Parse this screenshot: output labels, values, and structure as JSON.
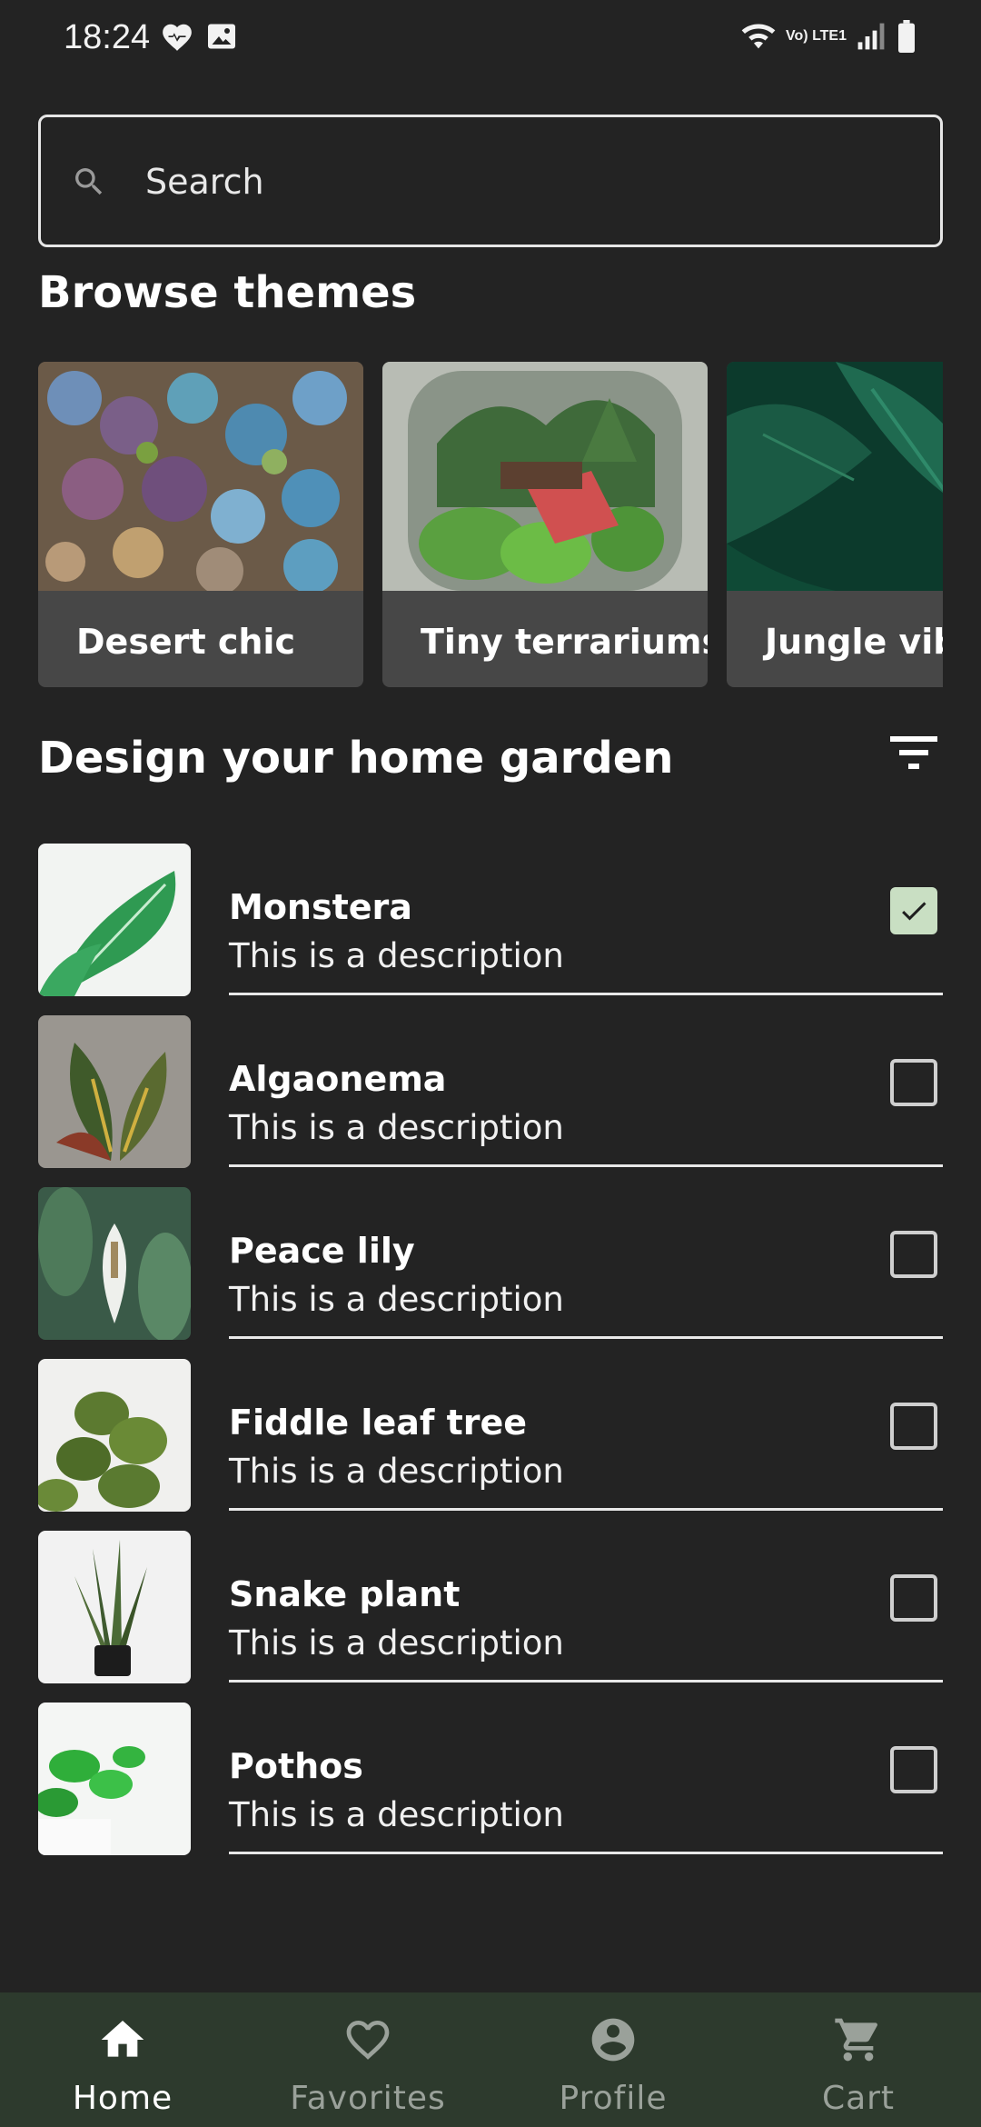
{
  "status_bar": {
    "time": "18:24",
    "network": "Vo) LTE1"
  },
  "search": {
    "placeholder": "Search"
  },
  "browse": {
    "title": "Browse themes",
    "themes": [
      {
        "label": "Desert chic"
      },
      {
        "label": "Tiny terrariums"
      },
      {
        "label": "Jungle vibes"
      }
    ]
  },
  "garden": {
    "title": "Design your home garden",
    "plants": [
      {
        "name": "Monstera",
        "description": "This is a description",
        "checked": true
      },
      {
        "name": "Algaonema",
        "description": "This is a description",
        "checked": false
      },
      {
        "name": "Peace lily",
        "description": "This is a description",
        "checked": false
      },
      {
        "name": "Fiddle leaf tree",
        "description": "This is a description",
        "checked": false
      },
      {
        "name": "Snake plant",
        "description": "This is a description",
        "checked": false
      },
      {
        "name": "Pothos",
        "description": "This is a description",
        "checked": false
      }
    ]
  },
  "nav": {
    "items": [
      {
        "label": "Home",
        "icon": "home-icon",
        "active": true
      },
      {
        "label": "Favorites",
        "icon": "heart-icon",
        "active": false
      },
      {
        "label": "Profile",
        "icon": "account-icon",
        "active": false
      },
      {
        "label": "Cart",
        "icon": "cart-icon",
        "active": false
      }
    ]
  },
  "colors": {
    "background": "#232323",
    "nav_background": "#2d3a2d",
    "checkbox_checked": "#c9dfc3"
  }
}
